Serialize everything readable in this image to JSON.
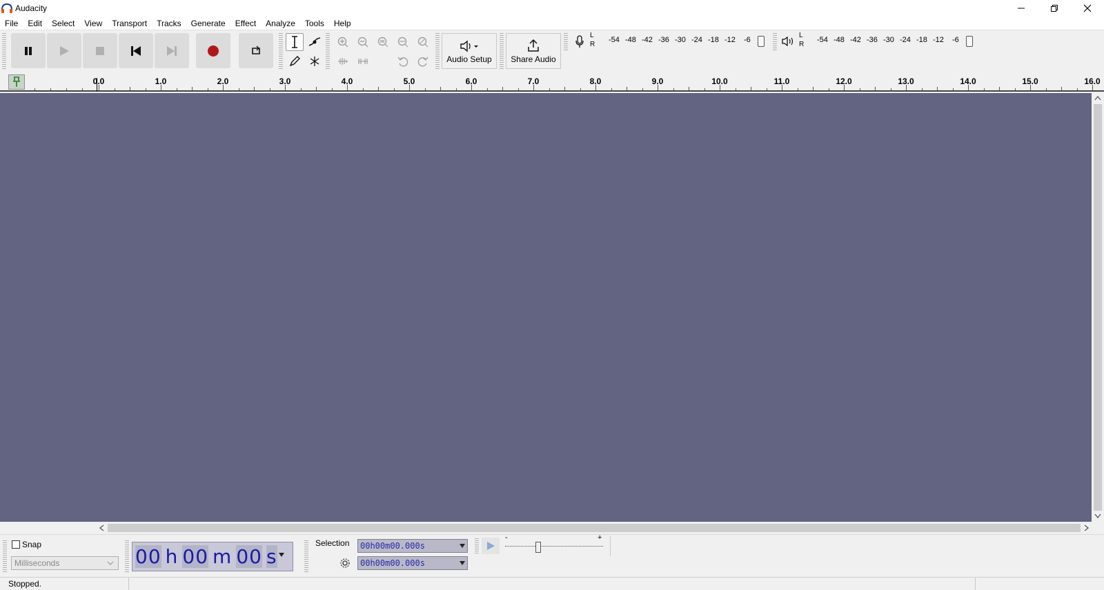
{
  "window": {
    "title": "Audacity"
  },
  "menu": [
    "File",
    "Edit",
    "Select",
    "View",
    "Transport",
    "Tracks",
    "Generate",
    "Effect",
    "Analyze",
    "Tools",
    "Help"
  ],
  "toolbar": {
    "audio_setup_label": "Audio Setup",
    "share_audio_label": "Share Audio"
  },
  "meters": {
    "record_l": "L",
    "record_r": "R",
    "play_l": "L",
    "play_r": "R",
    "scale": [
      "-54",
      "-48",
      "-42",
      "-36",
      "-30",
      "-24",
      "-18",
      "-12",
      "-6"
    ]
  },
  "ruler": {
    "labels": [
      "0.0",
      "1.0",
      "2.0",
      "3.0",
      "4.0",
      "5.0",
      "6.0",
      "7.0",
      "8.0",
      "9.0",
      "10.0",
      "11.0",
      "12.0",
      "13.0",
      "14.0",
      "15.0",
      "16.0"
    ]
  },
  "snap": {
    "label": "Snap",
    "checked": false,
    "unit": "Milliseconds"
  },
  "time": {
    "hours": "00",
    "h": "h",
    "minutes": "00",
    "m": "m",
    "seconds": "00",
    "s": "s"
  },
  "selection": {
    "label": "Selection",
    "start": "00h00m00.000s",
    "end": "00h00m00.000s"
  },
  "playback_speed": {
    "minus": "-",
    "plus": "+"
  },
  "status": {
    "text": "Stopped."
  }
}
